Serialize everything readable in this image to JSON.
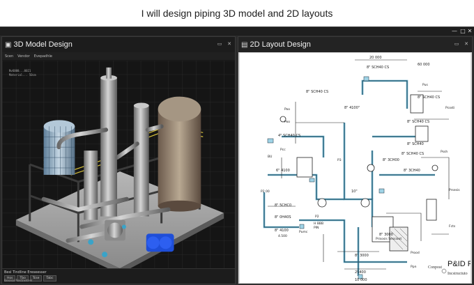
{
  "headline": "I will design piping 3D model and 2D layouts",
  "window": {
    "controls": [
      "—",
      "□",
      "✕"
    ]
  },
  "left_panel": {
    "title": "3D Model Design",
    "icon": "cube-icon",
    "controls": [
      "▭",
      "✕"
    ],
    "menu": [
      "Scen",
      "Vendor",
      "Evepadhle"
    ],
    "info_lines": [
      "Nv6000...0021",
      "Material... 50cm"
    ],
    "timeline_title": "Besl Tindline Ereseesser",
    "timeline_tabs": [
      "Hos",
      "Tbo",
      "Tcse",
      "Tabc"
    ],
    "status": "Beseai Restnetsel"
  },
  "right_panel": {
    "title": "2D Layout Design",
    "icon": "document-icon",
    "controls": [
      "▭",
      "✕"
    ],
    "dimensions": [
      "20 000",
      "8\" SCH40 CS",
      "8\" SCH40 CS",
      "8\" SCH40 CS",
      "8\" SCH40 CS",
      "8\" 4100\"",
      "4\" SCH40 CS",
      "8\" 3CH00",
      "8\" SCH40",
      "8\" 3CH40",
      "6\" 4100",
      "8\" 5CHC0",
      "8\" 0H40S",
      "8\" 4100",
      "8\" 3000",
      "10\"",
      "8\" 3000",
      "25400",
      "10 000",
      "60 000",
      "8\" SCH40 CS"
    ],
    "tags": [
      "Pus",
      "Poo",
      "Pcosti",
      "Poo",
      "Pcc",
      "P2 00",
      "P2",
      "P3",
      "Pssh",
      "Pumc",
      "Prsesis",
      "H BBB",
      "PIN",
      "4.500",
      "Prisosis Sessiont",
      "Prood",
      "BU",
      "Fcts",
      "Ppn"
    ],
    "legend_title": "P&ID PD",
    "legend_sub": "Incstructuto",
    "legend_left": "Conpost"
  }
}
